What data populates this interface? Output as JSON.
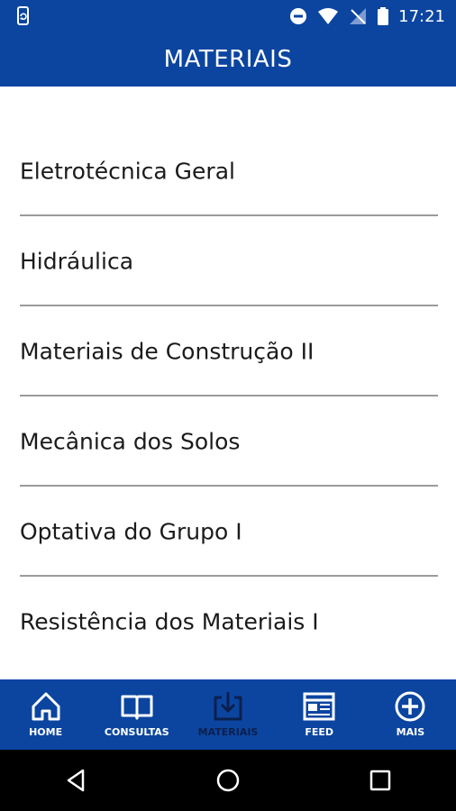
{
  "status_bar": {
    "time": "17:21"
  },
  "app_bar": {
    "title": "MATERIAIS"
  },
  "materials": [
    {
      "label": "Eletrotécnica Geral"
    },
    {
      "label": "Hidráulica"
    },
    {
      "label": "Materiais de Construção II"
    },
    {
      "label": "Mecânica dos Solos"
    },
    {
      "label": "Optativa do Grupo I"
    },
    {
      "label": "Resistência dos Materiais I"
    }
  ],
  "bottom_nav": {
    "items": [
      {
        "label": "HOME",
        "icon": "home-icon"
      },
      {
        "label": "CONSULTAS",
        "icon": "book-icon"
      },
      {
        "label": "MATERIAIS",
        "icon": "download-icon",
        "active": true
      },
      {
        "label": "FEED",
        "icon": "feed-icon"
      },
      {
        "label": "MAIS",
        "icon": "plus-circle-icon"
      }
    ]
  },
  "colors": {
    "primary": "#0b45a0",
    "active_nav": "#0b1f4d",
    "divider": "#9b9b9b"
  }
}
